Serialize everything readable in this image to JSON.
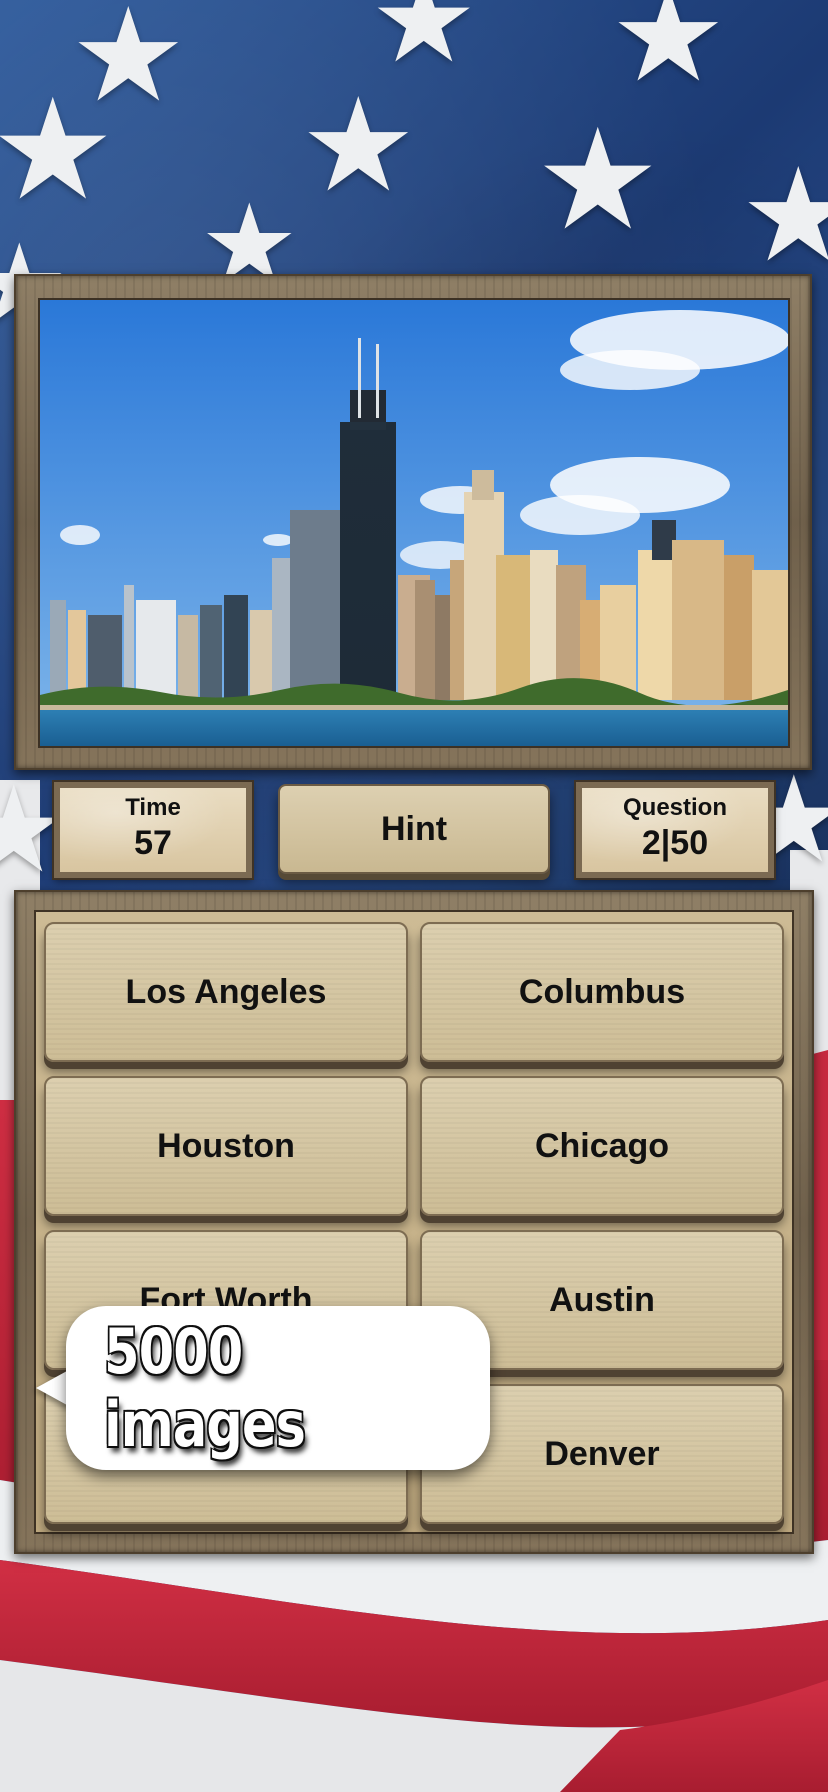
{
  "info": {
    "time_label": "Time",
    "time_value": "57",
    "question_label": "Question",
    "question_value": "2|50",
    "hint_label": "Hint"
  },
  "answers": [
    "Los Angeles",
    "Columbus",
    "Houston",
    "Chicago",
    "Fort Worth",
    "Austin",
    "",
    "Denver"
  ],
  "promo": {
    "bubble_text": "5000 images"
  },
  "colors": {
    "flag_blue": "#1c3a73",
    "flag_red": "#c8263c",
    "board_tan": "#cdbd96",
    "sky": "#2f7fd6",
    "water": "#1e6fa6"
  }
}
